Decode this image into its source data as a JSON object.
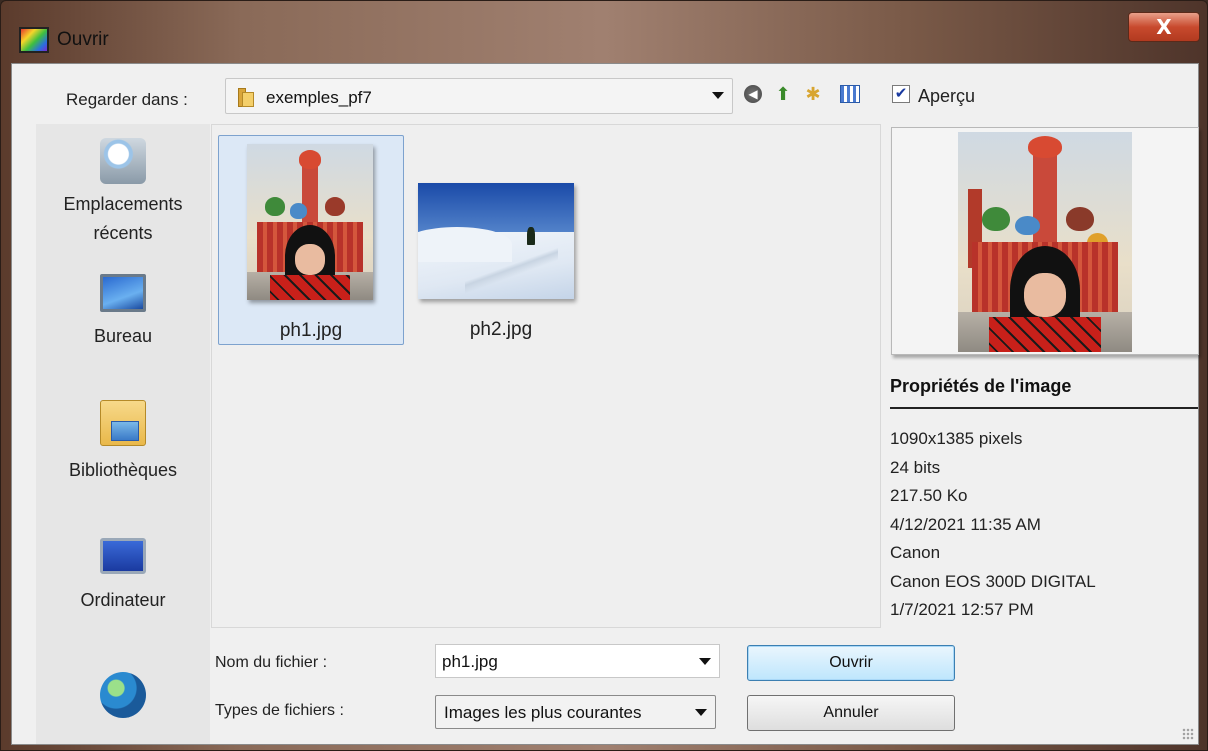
{
  "window": {
    "title": "Ouvrir",
    "close_label": "X"
  },
  "toolbar": {
    "look_in_label": "Regarder dans :",
    "look_in_value": "exemples_pf7",
    "back_icon": "back-icon",
    "up_icon": "up-folder-icon",
    "new_folder_icon": "new-folder-icon",
    "view_icon": "view-menu-icon",
    "preview_checkbox_label": "Aperçu",
    "preview_checked": true
  },
  "places": [
    {
      "label": "Emplacements récents",
      "icon": "recent-places-icon"
    },
    {
      "label": "Bureau",
      "icon": "desktop-icon"
    },
    {
      "label": "Bibliothèques",
      "icon": "libraries-icon"
    },
    {
      "label": "Ordinateur",
      "icon": "computer-icon"
    },
    {
      "label": "",
      "icon": "network-icon"
    }
  ],
  "files": [
    {
      "name": "ph1.jpg",
      "selected": true
    },
    {
      "name": "ph2.jpg",
      "selected": false
    }
  ],
  "preview": {
    "properties_title": "Propriétés de l'image",
    "properties": [
      "1090x1385 pixels",
      "24 bits",
      "217.50 Ko",
      "4/12/2021 11:35 AM",
      "Canon",
      "Canon EOS 300D DIGITAL",
      "1/7/2021 12:57 PM"
    ]
  },
  "form": {
    "filename_label": "Nom du fichier :",
    "filename_value": "ph1.jpg",
    "filetype_label": "Types de fichiers :",
    "filetype_value": "Images les plus courantes",
    "open_button": "Ouvrir",
    "cancel_button": "Annuler"
  },
  "colors": {
    "selection_bg": "#dce8f6",
    "selection_border": "#7da2ce",
    "default_button_border": "#3c7fb1",
    "close_button": "#c84a2e"
  }
}
